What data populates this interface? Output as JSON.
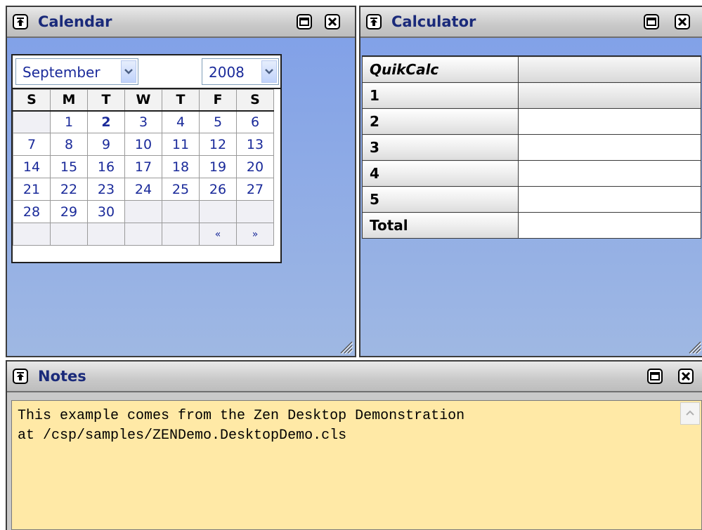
{
  "calendar": {
    "title": "Calendar",
    "month": "September",
    "year": "2008",
    "weekdays": [
      "S",
      "M",
      "T",
      "W",
      "T",
      "F",
      "S"
    ],
    "weeks": [
      [
        "",
        "1",
        "2",
        "3",
        "4",
        "5",
        "6"
      ],
      [
        "7",
        "8",
        "9",
        "10",
        "11",
        "12",
        "13"
      ],
      [
        "14",
        "15",
        "16",
        "17",
        "18",
        "19",
        "20"
      ],
      [
        "21",
        "22",
        "23",
        "24",
        "25",
        "26",
        "27"
      ],
      [
        "28",
        "29",
        "30",
        "",
        "",
        "",
        ""
      ]
    ],
    "today": "2",
    "prev_label": "«",
    "next_label": "»"
  },
  "calculator": {
    "title": "Calculator",
    "header": "QuikCalc",
    "rows": [
      "1",
      "2",
      "3",
      "4",
      "5"
    ],
    "total_label": "Total"
  },
  "notes": {
    "title": "Notes",
    "text": "This example comes from the Zen Desktop Demonstration\nat /csp/samples/ZENDemo.DesktopDemo.cls"
  },
  "colors": {
    "title_text": "#1a2a7a",
    "desktop_gradient_top": "#7f9fe8",
    "desktop_gradient_bottom": "#9fb8e3",
    "notes_bg": "#ffe9a6"
  },
  "icons": [
    "collapse-icon",
    "maximize-icon",
    "close-icon",
    "resize-grip-icon",
    "chevron-down-icon"
  ]
}
